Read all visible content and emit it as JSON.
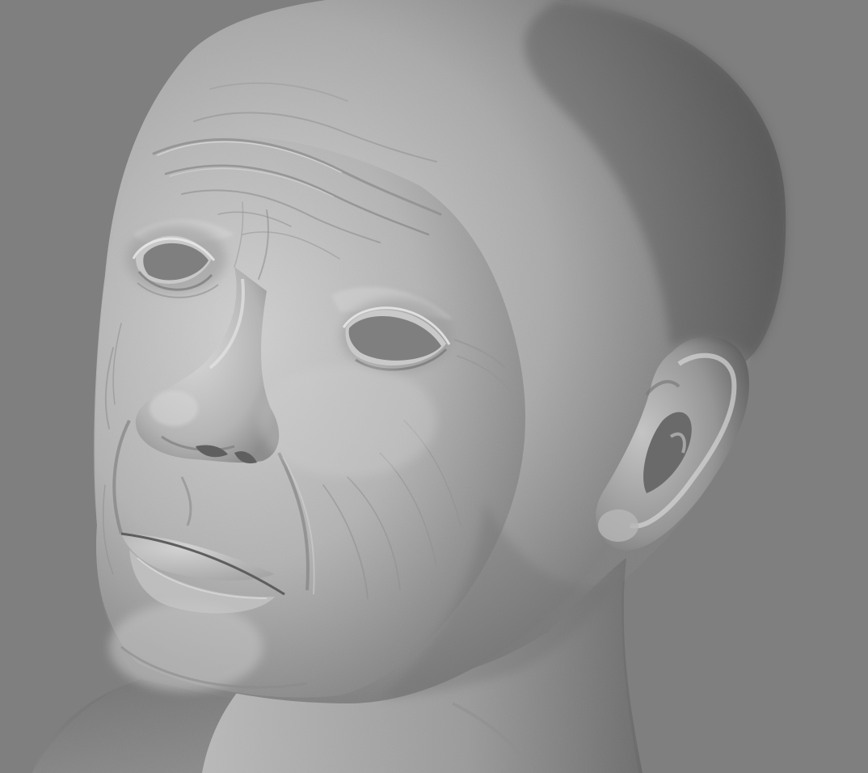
{
  "viewport": {
    "background_color": "#7f7f7f",
    "material_color": "#b9b9b9"
  },
  "model": {
    "subject": "sculpted-head"
  }
}
